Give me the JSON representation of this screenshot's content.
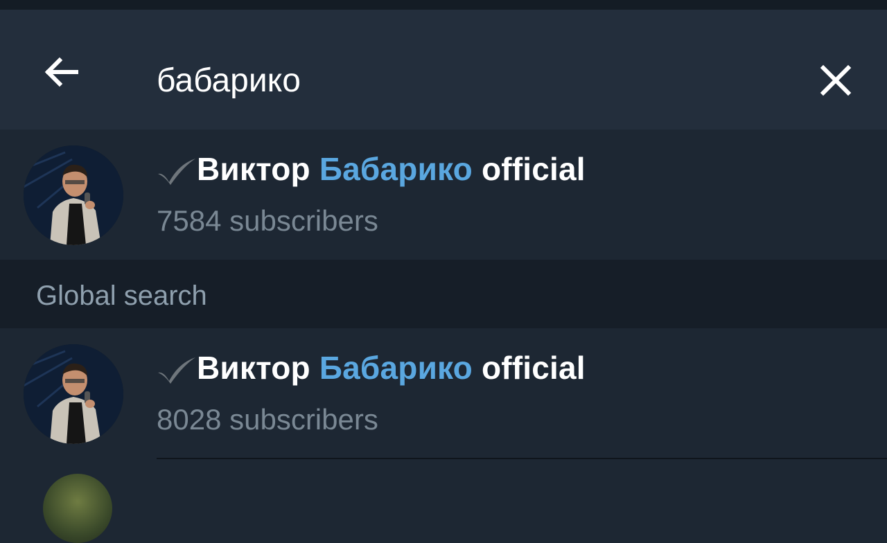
{
  "search": {
    "query": "бабарико",
    "back_icon": "arrow-left-icon",
    "clear_icon": "close-icon"
  },
  "results": [
    {
      "name_prefix": "Виктор ",
      "name_highlight": "Бабарико",
      "name_suffix": " official",
      "verified": true,
      "subscribers": "7584 subscribers"
    }
  ],
  "global_search": {
    "title": "Global search",
    "results": [
      {
        "name_prefix": "Виктор ",
        "name_highlight": "Бабарико",
        "name_suffix": " official",
        "verified": true,
        "subscribers": "8028 subscribers"
      }
    ]
  },
  "colors": {
    "background": "#1d2733",
    "header": "#232e3c",
    "section_header": "#161e28",
    "highlight": "#5aa7e0",
    "secondary_text": "#7a8894"
  }
}
